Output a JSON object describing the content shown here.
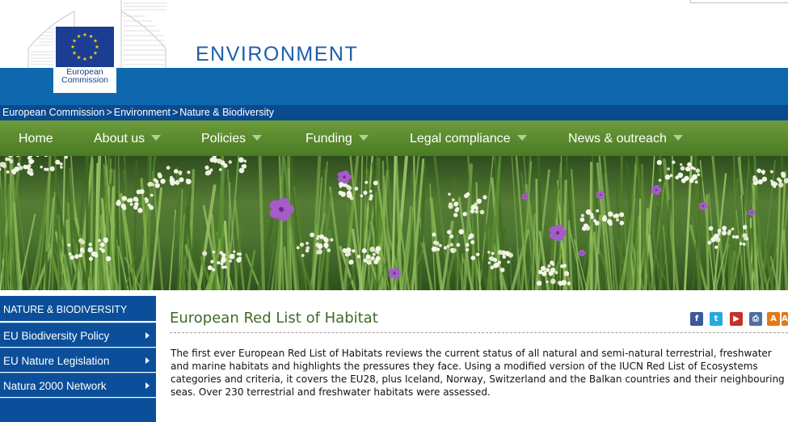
{
  "header": {
    "logo_line1": "European",
    "logo_line2": "Commission",
    "site_title": "ENVIRONMENT"
  },
  "breadcrumb": {
    "items": [
      "European Commission",
      "Environment",
      "Nature & Biodiversity"
    ],
    "separator": ">"
  },
  "nav": {
    "items": [
      {
        "label": "Home",
        "has_menu": false
      },
      {
        "label": "About us",
        "has_menu": true
      },
      {
        "label": "Policies",
        "has_menu": true
      },
      {
        "label": "Funding",
        "has_menu": true
      },
      {
        "label": "Legal compliance",
        "has_menu": true
      },
      {
        "label": "News & outreach",
        "has_menu": true
      }
    ]
  },
  "sidebar": {
    "header": "NATURE & BIODIVERSITY",
    "items": [
      {
        "label": "EU Biodiversity Policy"
      },
      {
        "label": "EU Nature Legislation"
      },
      {
        "label": "Natura 2000 Network"
      }
    ]
  },
  "main": {
    "title": "European Red List of Habitat",
    "intro": "The first ever European Red List of Habitats reviews the current status of all natural and semi-natural terrestrial, freshwater and marine habitats and highlights the pressures they face. Using a modified version of the IUCN Red List of Ecosystems categories and criteria, it covers the EU28, plus Iceland, Norway, Switzerland and the Balkan countries and their neighbouring seas. Over 230 terrestrial and freshwater habitats were assessed.",
    "share_icons": [
      {
        "name": "facebook-icon",
        "glyph": "f",
        "color": "#3b5998"
      },
      {
        "name": "twitter-icon",
        "glyph": "t",
        "color": "#2aa9e0"
      },
      {
        "name": "youtube-icon",
        "glyph": "▶",
        "color": "#c4302b"
      },
      {
        "name": "print-icon",
        "glyph": "⎙",
        "color": "#4a6fa5"
      },
      {
        "name": "font-size-icon",
        "glyph": "A",
        "color": "#e07b1a"
      }
    ]
  },
  "colors": {
    "brand_blue": "#0f68ae",
    "dark_blue": "#0a4a8f",
    "nav_green": "#5a8a2e",
    "title_green": "#3f6a27"
  }
}
